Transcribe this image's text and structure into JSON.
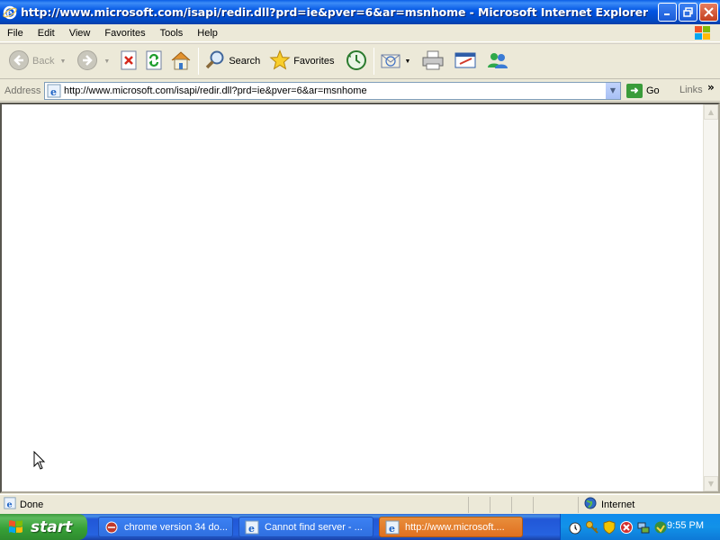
{
  "window": {
    "title": "http://www.microsoft.com/isapi/redir.dll?prd=ie&pver=6&ar=msnhome - Microsoft Internet Explorer"
  },
  "menu": {
    "items": [
      "File",
      "Edit",
      "View",
      "Favorites",
      "Tools",
      "Help"
    ]
  },
  "toolbar": {
    "back_label": "Back",
    "search_label": "Search",
    "favorites_label": "Favorites"
  },
  "address": {
    "label": "Address",
    "value": "http://www.microsoft.com/isapi/redir.dll?prd=ie&pver=6&ar=msnhome",
    "go_label": "Go",
    "links_label": "Links"
  },
  "status": {
    "text": "Done",
    "zone": "Internet"
  },
  "taskbar": {
    "start_label": "start",
    "tasks": [
      {
        "label": "chrome version 34 do...",
        "active": false
      },
      {
        "label": "Cannot find server - ...",
        "active": false
      },
      {
        "label": "http://www.microsoft....",
        "active": true
      }
    ],
    "clock": "9:55 PM"
  },
  "icons": {
    "title": "ie-icon",
    "tray": [
      "clock-alarm-icon",
      "keys-icon",
      "shield-icon",
      "antivirus-icon",
      "network-icon",
      "windows-update-icon"
    ]
  },
  "colors": {
    "titlebar": "#0054E3",
    "start_green": "#37A137",
    "active_task": "#E07020"
  }
}
